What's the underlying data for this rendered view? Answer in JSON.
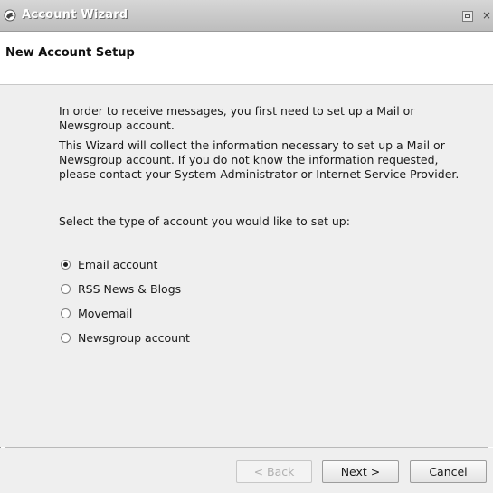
{
  "window": {
    "title": "Account Wizard",
    "close_glyph": "×"
  },
  "header": {
    "title": "New Account Setup"
  },
  "intro": {
    "p1": "In order to receive messages, you first need to set up a Mail or Newsgroup account.",
    "p2": "This Wizard will collect the information necessary to set up a Mail or Newsgroup account. If you do not know the information requested, please contact your System Administrator or Internet Service Provider.",
    "p3": "Select the type of account you would like to set up:"
  },
  "account_types": [
    {
      "label": "Email account",
      "checked": true
    },
    {
      "label": "RSS News & Blogs",
      "checked": false
    },
    {
      "label": "Movemail",
      "checked": false
    },
    {
      "label": "Newsgroup account",
      "checked": false
    }
  ],
  "buttons": {
    "back": "< Back",
    "next": "Next >",
    "cancel": "Cancel"
  },
  "icons": {
    "app": "seamonkey-icon",
    "maximize": "maximize-icon",
    "close": "close-icon"
  }
}
